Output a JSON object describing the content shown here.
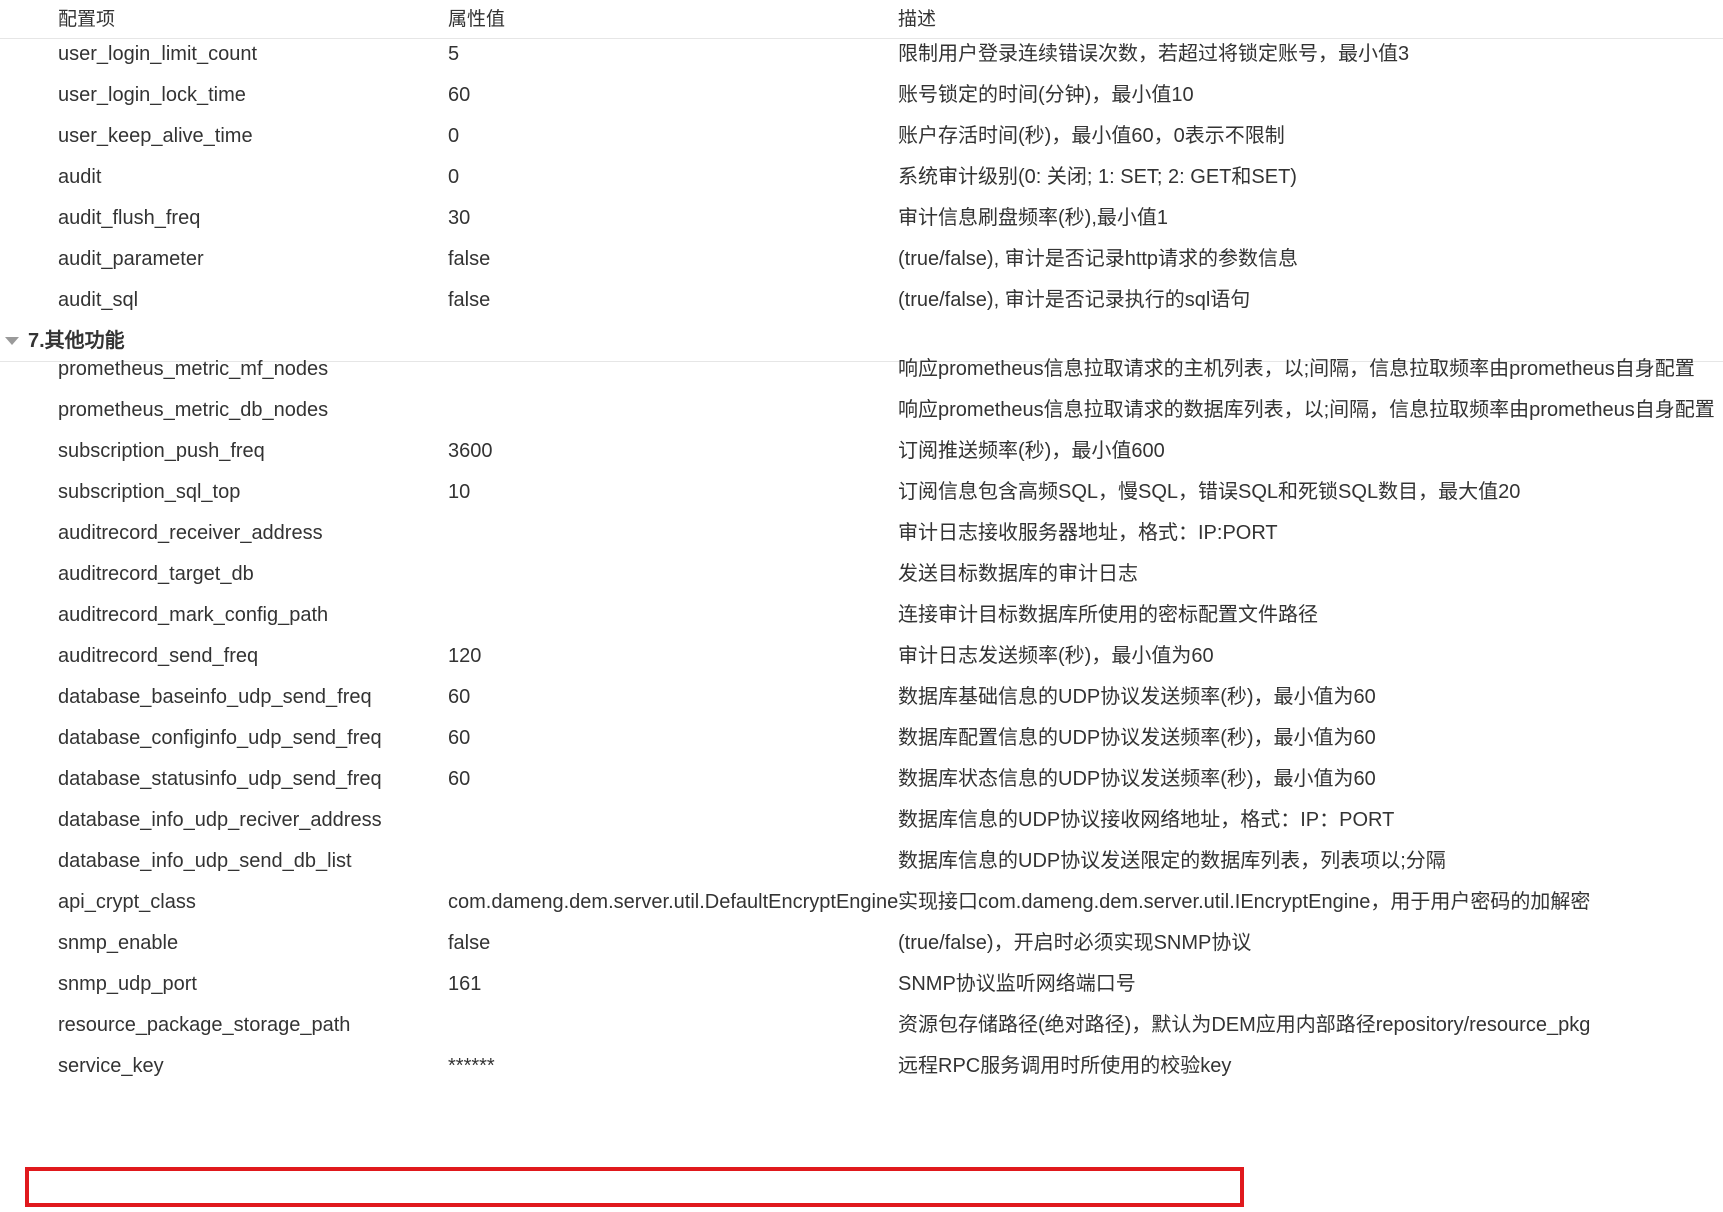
{
  "columns": {
    "name": "配置项",
    "value": "属性值",
    "desc": "描述"
  },
  "rows_top": [
    {
      "name": "user_login_limit_count",
      "value": "5",
      "desc": "限制用户登录连续错误次数，若超过将锁定账号，最小值3"
    },
    {
      "name": "user_login_lock_time",
      "value": "60",
      "desc": "账号锁定的时间(分钟)，最小值10"
    },
    {
      "name": "user_keep_alive_time",
      "value": "0",
      "desc": "账户存活时间(秒)，最小值60，0表示不限制"
    },
    {
      "name": "audit",
      "value": "0",
      "desc": "系统审计级别(0: 关闭; 1: SET; 2: GET和SET)"
    },
    {
      "name": "audit_flush_freq",
      "value": "30",
      "desc": "审计信息刷盘频率(秒),最小值1"
    },
    {
      "name": "audit_parameter",
      "value": "false",
      "desc": "(true/false), 审计是否记录http请求的参数信息"
    },
    {
      "name": "audit_sql",
      "value": "false",
      "desc": "(true/false), 审计是否记录执行的sql语句"
    }
  ],
  "group": {
    "title": "7.其他功能",
    "caret_icon": "caret-down-icon"
  },
  "rows_group": [
    {
      "name": "prometheus_metric_mf_nodes",
      "value": "",
      "desc": "响应prometheus信息拉取请求的主机列表，以;间隔，信息拉取频率由prometheus自身配置"
    },
    {
      "name": "prometheus_metric_db_nodes",
      "value": "",
      "desc": "响应prometheus信息拉取请求的数据库列表，以;间隔，信息拉取频率由prometheus自身配置"
    },
    {
      "name": "subscription_push_freq",
      "value": "3600",
      "desc": "订阅推送频率(秒)，最小值600"
    },
    {
      "name": "subscription_sql_top",
      "value": "10",
      "desc": "订阅信息包含高频SQL，慢SQL，错误SQL和死锁SQL数目，最大值20"
    },
    {
      "name": "auditrecord_receiver_address",
      "value": "",
      "desc": "审计日志接收服务器地址，格式：IP:PORT"
    },
    {
      "name": "auditrecord_target_db",
      "value": "",
      "desc": "发送目标数据库的审计日志"
    },
    {
      "name": "auditrecord_mark_config_path",
      "value": "",
      "desc": "连接审计目标数据库所使用的密标配置文件路径"
    },
    {
      "name": "auditrecord_send_freq",
      "value": "120",
      "desc": "审计日志发送频率(秒)，最小值为60"
    },
    {
      "name": "database_baseinfo_udp_send_freq",
      "value": "60",
      "desc": "数据库基础信息的UDP协议发送频率(秒)，最小值为60"
    },
    {
      "name": "database_configinfo_udp_send_freq",
      "value": "60",
      "desc": "数据库配置信息的UDP协议发送频率(秒)，最小值为60"
    },
    {
      "name": "database_statusinfo_udp_send_freq",
      "value": "60",
      "desc": "数据库状态信息的UDP协议发送频率(秒)，最小值为60"
    },
    {
      "name": "database_info_udp_reciver_address",
      "value": "",
      "desc": "数据库信息的UDP协议接收网络地址，格式：IP：PORT"
    },
    {
      "name": "database_info_udp_send_db_list",
      "value": "",
      "desc": "数据库信息的UDP协议发送限定的数据库列表，列表项以;分隔"
    },
    {
      "name": "api_crypt_class",
      "value": "com.dameng.dem.server.util.DefaultEncryptEngine",
      "desc": "实现接口com.dameng.dem.server.util.IEncryptEngine，用于用户密码的加解密"
    },
    {
      "name": "snmp_enable",
      "value": "false",
      "desc": "(true/false)，开启时必须实现SNMP协议"
    },
    {
      "name": "snmp_udp_port",
      "value": "161",
      "desc": "SNMP协议监听网络端口号"
    },
    {
      "name": "resource_package_storage_path",
      "value": "",
      "desc": "资源包存储路径(绝对路径)，默认为DEM应用内部路径repository/resource_pkg"
    },
    {
      "name": "service_key",
      "value": "******",
      "desc": "远程RPC服务调用时所使用的校验key"
    }
  ],
  "highlight_color": "#e0191d"
}
